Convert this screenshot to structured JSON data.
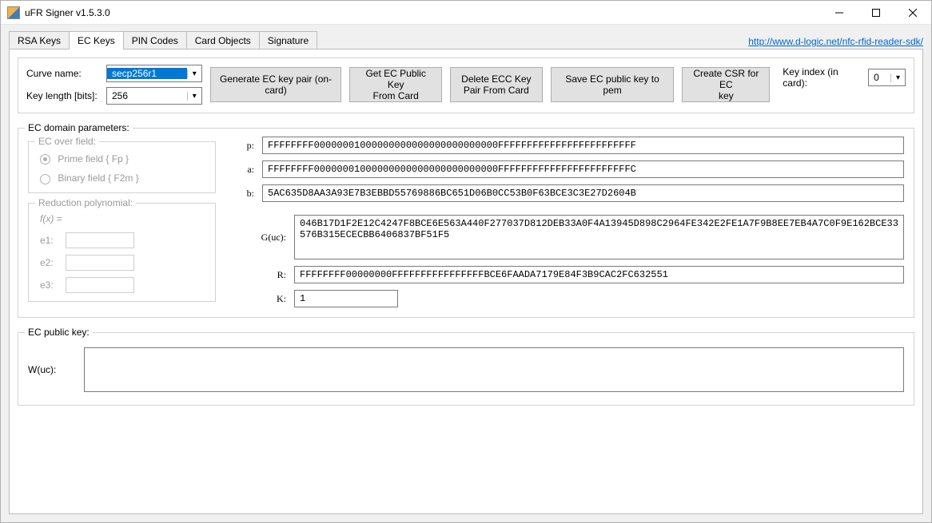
{
  "window": {
    "title": "uFR Signer v1.5.3.0"
  },
  "link": {
    "text": "http://www.d-logic.net/nfc-rfid-reader-sdk/",
    "href": "http://www.d-logic.net/nfc-rfid-reader-sdk/"
  },
  "tabs": [
    "RSA Keys",
    "EC Keys",
    "PIN Codes",
    "Card Objects",
    "Signature"
  ],
  "active_tab": 1,
  "toolbar": {
    "curve_label": "Curve name:",
    "curve_value": "secp256r1",
    "keylen_label": "Key length [bits]:",
    "keylen_value": "256",
    "keyindex_label": "Key index (in card):",
    "keyindex_value": "0",
    "buttons": {
      "gen": "Generate EC key pair (on-card)",
      "getpub": "Get EC Public Key\nFrom Card",
      "delete": "Delete ECC Key\nPair From Card",
      "savepem": "Save EC public key to pem",
      "csr": "Create CSR for EC\nkey"
    }
  },
  "domain": {
    "title": "EC domain parameters:",
    "field_title": "EC over field:",
    "radio_prime": "Prime field { Fp }",
    "radio_binary": "Binary field { F2m }",
    "redpoly_title": "Reduction polynomial:",
    "fx_label": "f(x) =",
    "e1_label": "e1:",
    "e2_label": "e2:",
    "e3_label": "e3:",
    "labels": {
      "p": "p:",
      "a": "a:",
      "b": "b:",
      "G": "G(uc):",
      "R": "R:",
      "K": "K:"
    },
    "p": "FFFFFFFF00000001000000000000000000000000FFFFFFFFFFFFFFFFFFFFFFFF",
    "a": "FFFFFFFF00000001000000000000000000000000FFFFFFFFFFFFFFFFFFFFFFFC",
    "b": "5AC635D8AA3A93E7B3EBBD55769886BC651D06B0CC53B0F63BCE3C3E27D2604B",
    "G": "046B17D1F2E12C4247F8BCE6E563A440F277037D812DEB33A0F4A13945D898C2964FE342E2FE1A7F9B8EE7EB4A7C0F9E162BCE33576B315ECECBB6406837BF51F5",
    "R": "FFFFFFFF00000000FFFFFFFFFFFFFFFFBCE6FAADA7179E84F3B9CAC2FC632551",
    "K": "1"
  },
  "pubkey": {
    "title": "EC public key:",
    "label": "W(uc):",
    "value": ""
  }
}
